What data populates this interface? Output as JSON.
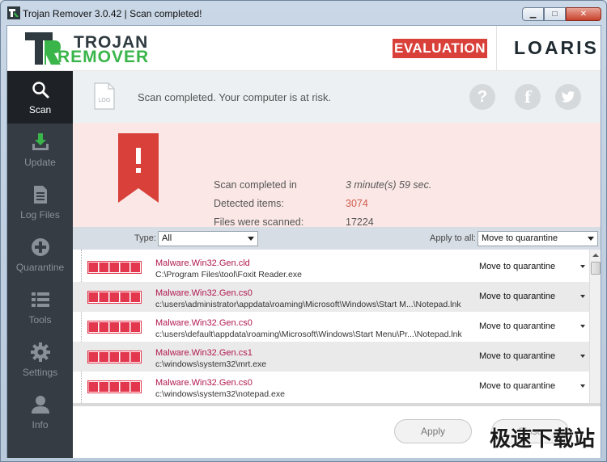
{
  "window": {
    "title": "Trojan Remover 3.0.42 | Scan completed!"
  },
  "header": {
    "logo_line1": "TROJAN",
    "logo_line2": "REMOVER",
    "evaluation": "EVALUATION",
    "brand": "LOARIS"
  },
  "sidebar": {
    "items": [
      {
        "label": "Scan",
        "icon": "search-icon",
        "active": true
      },
      {
        "label": "Update",
        "icon": "download-icon"
      },
      {
        "label": "Log Files",
        "icon": "document-icon"
      },
      {
        "label": "Quarantine",
        "icon": "plus-circle-icon"
      },
      {
        "label": "Tools",
        "icon": "list-icon"
      },
      {
        "label": "Settings",
        "icon": "gear-icon"
      },
      {
        "label": "Info",
        "icon": "person-icon"
      }
    ]
  },
  "status": {
    "text": "Scan completed. Your computer is at risk.",
    "log_icon_text": "LOG"
  },
  "summary": {
    "rows": [
      {
        "label": "Scan completed in",
        "value": "3 minute(s) 59 sec."
      },
      {
        "label": "Detected items:",
        "value": "3074"
      },
      {
        "label": "Files were scanned:",
        "value": "17224"
      }
    ],
    "accent": "#d9403a"
  },
  "filter": {
    "type_label": "Type:",
    "type_value": "All",
    "apply_label": "Apply to all:",
    "apply_value": "Move to quarantine"
  },
  "items": [
    {
      "name": "Malware.Win32.Gen.cld",
      "path": "C:\\Program Files\\tool\\Foxit Reader.exe",
      "action": "Move to quarantine"
    },
    {
      "name": "Malware.Win32.Gen.cs0",
      "path": "c:\\users\\administrator\\appdata\\roaming\\Microsoft\\Windows\\Start M...\\Notepad.lnk",
      "action": "Move to quarantine"
    },
    {
      "name": "Malware.Win32.Gen.cs0",
      "path": "c:\\users\\default\\appdata\\roaming\\Microsoft\\Windows\\Start Menu\\Pr...\\Notepad.lnk",
      "action": "Move to quarantine"
    },
    {
      "name": "Malware.Win32.Gen.cs1",
      "path": "c:\\windows\\system32\\mrt.exe",
      "action": "Move to quarantine"
    },
    {
      "name": "Malware.Win32.Gen.cs0",
      "path": "c:\\windows\\system32\\notepad.exe",
      "action": "Move to quarantine"
    }
  ],
  "footer": {
    "apply_label": "Apply",
    "second_label": "Close"
  },
  "watermark": "极速下载站"
}
